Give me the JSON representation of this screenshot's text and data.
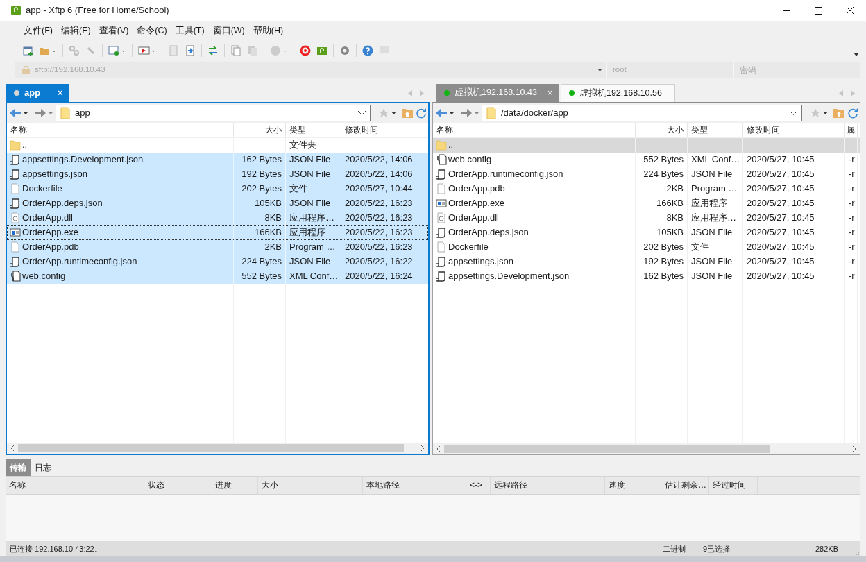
{
  "window": {
    "title": "app - Xftp 6 (Free for Home/School)"
  },
  "menu": [
    "文件(F)",
    "编辑(E)",
    "查看(V)",
    "命令(C)",
    "工具(T)",
    "窗口(W)",
    "帮助(H)"
  ],
  "address_bar": {
    "url": "sftp://192.168.10.43",
    "username": "root",
    "password_placeholder": "密码"
  },
  "panes": [
    {
      "active": true,
      "tabs": [
        {
          "label": "app",
          "close": "×",
          "selected": true,
          "color": "#d4d4d4"
        }
      ],
      "path": "app",
      "columns": [
        "名称",
        "大小",
        "类型",
        "修改时间"
      ],
      "rows": [
        {
          "kind": "folder",
          "name": "..",
          "type": "文件夹",
          "selected": false,
          "focused": false
        },
        {
          "kind": "json",
          "name": "appsettings.Development.json",
          "size": "162 Bytes",
          "type": "JSON File",
          "modified": "2020/5/22, 14:06",
          "selected": true,
          "focused": false
        },
        {
          "kind": "json",
          "name": "appsettings.json",
          "size": "192 Bytes",
          "type": "JSON File",
          "modified": "2020/5/22, 14:06",
          "selected": true,
          "focused": false
        },
        {
          "kind": "file",
          "name": "Dockerfile",
          "size": "202 Bytes",
          "type": "文件",
          "modified": "2020/5/27, 10:44",
          "selected": true,
          "focused": false
        },
        {
          "kind": "json",
          "name": "OrderApp.deps.json",
          "size": "105KB",
          "type": "JSON File",
          "modified": "2020/5/22, 16:23",
          "selected": true,
          "focused": false
        },
        {
          "kind": "dll",
          "name": "OrderApp.dll",
          "size": "8KB",
          "type": "应用程序…",
          "modified": "2020/5/22, 16:23",
          "selected": true,
          "focused": false
        },
        {
          "kind": "exe",
          "name": "OrderApp.exe",
          "size": "166KB",
          "type": "应用程序",
          "modified": "2020/5/22, 16:23",
          "selected": true,
          "focused": true
        },
        {
          "kind": "file",
          "name": "OrderApp.pdb",
          "size": "2KB",
          "type": "Program …",
          "modified": "2020/5/22, 16:23",
          "selected": true,
          "focused": false
        },
        {
          "kind": "json",
          "name": "OrderApp.runtimeconfig.json",
          "size": "224 Bytes",
          "type": "JSON File",
          "modified": "2020/5/22, 16:22",
          "selected": true,
          "focused": false
        },
        {
          "kind": "config",
          "name": "web.config",
          "size": "552 Bytes",
          "type": "XML Conf…",
          "modified": "2020/5/22, 16:24",
          "selected": true,
          "focused": false
        }
      ]
    },
    {
      "active": false,
      "tabs": [
        {
          "label": "虚拟机192.168.10.43",
          "close": "×",
          "selected": true,
          "color": "#12b312"
        },
        {
          "label": "虚拟机192.168.10.56",
          "selected": false,
          "color": "#12b312"
        }
      ],
      "path": "/data/docker/app",
      "columns": [
        "名称",
        "大小",
        "类型",
        "修改时间",
        "属"
      ],
      "rows": [
        {
          "kind": "folder",
          "name": "..",
          "selected": true,
          "focused": false
        },
        {
          "kind": "config",
          "name": "web.config",
          "size": "552 Bytes",
          "type": "XML Conf…",
          "modified": "2020/5/27, 10:45",
          "column_5": "-r",
          "selected": false,
          "focused": false
        },
        {
          "kind": "json",
          "name": "OrderApp.runtimeconfig.json",
          "size": "224 Bytes",
          "type": "JSON File",
          "modified": "2020/5/27, 10:45",
          "column_5": "-r",
          "selected": false,
          "focused": false
        },
        {
          "kind": "file",
          "name": "OrderApp.pdb",
          "size": "2KB",
          "type": "Program …",
          "modified": "2020/5/27, 10:45",
          "column_5": "-r",
          "selected": false,
          "focused": false
        },
        {
          "kind": "exe",
          "name": "OrderApp.exe",
          "size": "166KB",
          "type": "应用程序",
          "modified": "2020/5/27, 10:45",
          "column_5": "-r",
          "selected": false,
          "focused": false
        },
        {
          "kind": "dll",
          "name": "OrderApp.dll",
          "size": "8KB",
          "type": "应用程序…",
          "modified": "2020/5/27, 10:45",
          "column_5": "-r",
          "selected": false,
          "focused": false
        },
        {
          "kind": "json",
          "name": "OrderApp.deps.json",
          "size": "105KB",
          "type": "JSON File",
          "modified": "2020/5/27, 10:45",
          "column_5": "-r",
          "selected": false,
          "focused": false
        },
        {
          "kind": "file",
          "name": "Dockerfile",
          "size": "202 Bytes",
          "type": "文件",
          "modified": "2020/5/27, 10:45",
          "column_5": "-r",
          "selected": false,
          "focused": false
        },
        {
          "kind": "json",
          "name": "appsettings.json",
          "size": "192 Bytes",
          "type": "JSON File",
          "modified": "2020/5/27, 10:45",
          "column_5": "-r",
          "selected": false,
          "focused": false
        },
        {
          "kind": "json",
          "name": "appsettings.Development.json",
          "size": "162 Bytes",
          "type": "JSON File",
          "modified": "2020/5/27, 10:45",
          "column_5": "-r",
          "selected": false,
          "focused": false
        }
      ]
    }
  ],
  "transfer": {
    "tabs": [
      {
        "label": "传输",
        "selected": true
      },
      {
        "label": "日志",
        "selected": false
      }
    ],
    "columns": [
      "名称",
      "状态",
      "进度",
      "大小",
      "本地路径",
      "<->",
      "远程路径",
      "速度",
      "估计剩余…",
      "经过时间"
    ]
  },
  "status_bar": {
    "connection": "已连接 192.168.10.43:22。",
    "mode": "二进制",
    "selection": "9已选择",
    "size": "282KB"
  }
}
